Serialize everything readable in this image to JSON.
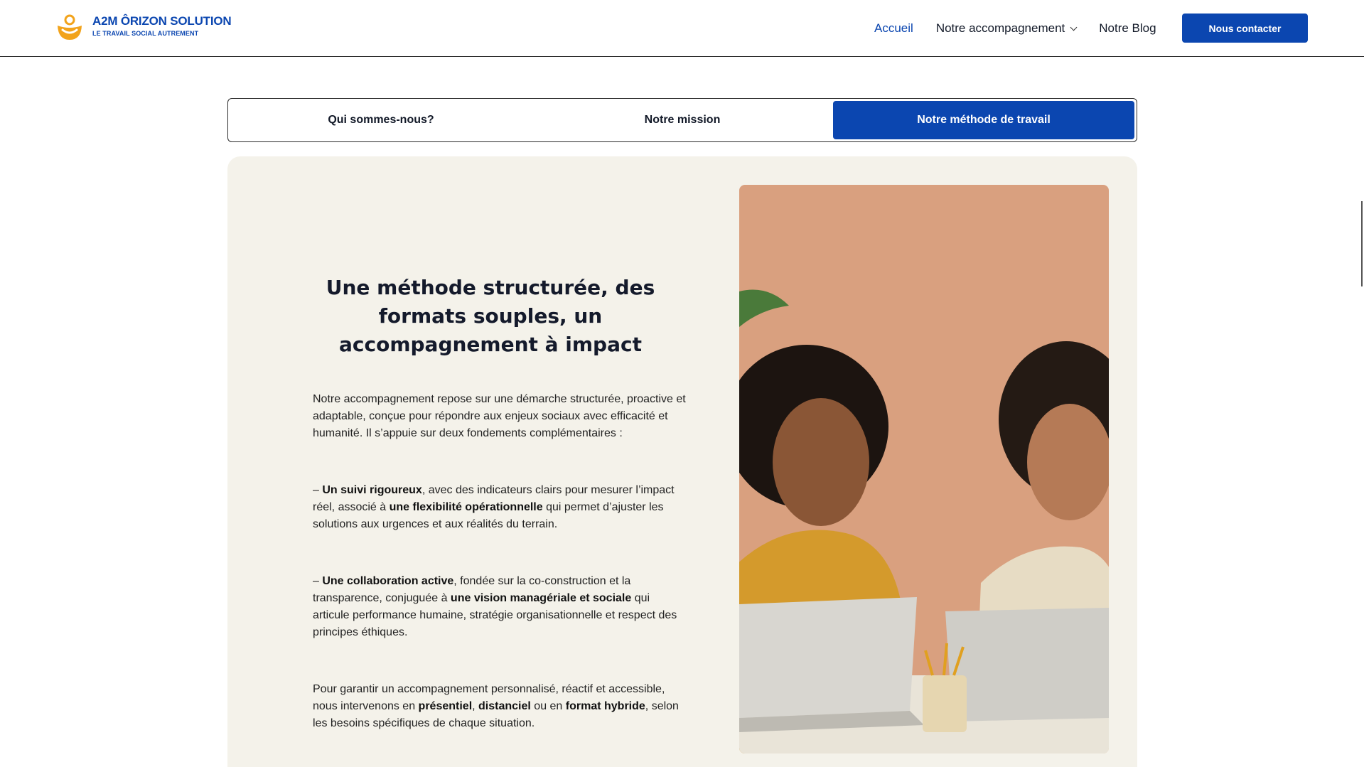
{
  "header": {
    "logo_title": "A2M ÔRIZON SOLUTION",
    "logo_subtitle": "LE TRAVAIL SOCIAL AUTREMENT",
    "nav": [
      {
        "label": "Accueil",
        "active": true
      },
      {
        "label": "Notre accompagnement",
        "has_dropdown": true
      },
      {
        "label": "Notre Blog"
      }
    ],
    "cta_label": "Nous contacter"
  },
  "tabs": [
    {
      "label": "Qui sommes-nous?"
    },
    {
      "label": "Notre mission"
    },
    {
      "label": "Notre méthode de travail",
      "active": true
    }
  ],
  "content": {
    "title": "Une méthode structurée, des formats souples, un accompagnement à impact",
    "intro": "Notre accompagnement repose sur une démarche structurée, proactive et adaptable, conçue pour répondre aux enjeux sociaux avec efficacité et humanité. Il s’appuie sur deux fondements complémentaires :",
    "p1": {
      "prefix": "– ",
      "b1": "Un suivi rigoureux",
      "t1": ", avec des indicateurs clairs pour mesurer l’impact réel, associé à ",
      "b2": "une flexibilité opérationnelle",
      "t2": " qui permet d’ajuster les solutions aux urgences et aux réalités du terrain."
    },
    "p2": {
      "prefix": "– ",
      "b1": "Une collaboration active",
      "t1": ", fondée sur la co-construction et la transparence, conjuguée à ",
      "b2": "une vision managériale et sociale",
      "t2": " qui articule performance humaine, stratégie organisationnelle et respect des principes éthiques."
    },
    "p3": {
      "t0": "Pour garantir un accompagnement personnalisé, réactif et accessible, nous intervenons en ",
      "b1": "présentiel",
      "t1": ", ",
      "b2": "distanciel",
      "t2": " ou en ",
      "b3": "format hybride",
      "t3": ", selon les besoins spécifiques de chaque situation."
    }
  },
  "colors": {
    "brand_blue": "#0b46b0",
    "logo_orange": "#f2a31b",
    "card_bg": "#f4f2ea",
    "photo_bg": "#d9a07f"
  }
}
